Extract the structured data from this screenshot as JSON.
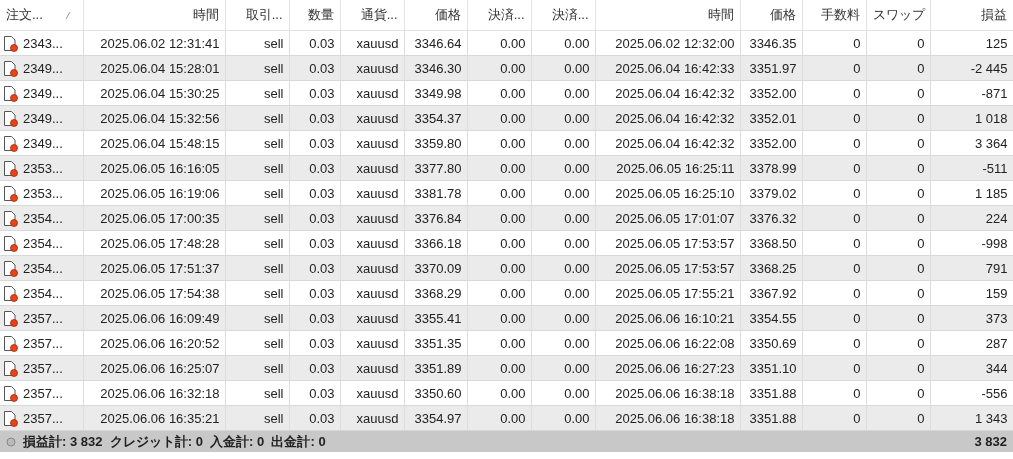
{
  "table": {
    "columns": [
      "注文...",
      "時間",
      "取引...",
      "数量",
      "通貨...",
      "価格",
      "決済...",
      "決済...",
      "時間",
      "価格",
      "手数料",
      "スワップ",
      "損益"
    ],
    "rows": [
      [
        "2343...",
        "2025.06.02 12:31:41",
        "sell",
        "0.03",
        "xauusd",
        "3346.64",
        "0.00",
        "0.00",
        "2025.06.02 12:32:00",
        "3346.35",
        "0",
        "0",
        "125"
      ],
      [
        "2349...",
        "2025.06.04 15:28:01",
        "sell",
        "0.03",
        "xauusd",
        "3346.30",
        "0.00",
        "0.00",
        "2025.06.04 16:42:33",
        "3351.97",
        "0",
        "0",
        "-2 445"
      ],
      [
        "2349...",
        "2025.06.04 15:30:25",
        "sell",
        "0.03",
        "xauusd",
        "3349.98",
        "0.00",
        "0.00",
        "2025.06.04 16:42:32",
        "3352.00",
        "0",
        "0",
        "-871"
      ],
      [
        "2349...",
        "2025.06.04 15:32:56",
        "sell",
        "0.03",
        "xauusd",
        "3354.37",
        "0.00",
        "0.00",
        "2025.06.04 16:42:32",
        "3352.01",
        "0",
        "0",
        "1 018"
      ],
      [
        "2349...",
        "2025.06.04 15:48:15",
        "sell",
        "0.03",
        "xauusd",
        "3359.80",
        "0.00",
        "0.00",
        "2025.06.04 16:42:32",
        "3352.00",
        "0",
        "0",
        "3 364"
      ],
      [
        "2353...",
        "2025.06.05 16:16:05",
        "sell",
        "0.03",
        "xauusd",
        "3377.80",
        "0.00",
        "0.00",
        "2025.06.05 16:25:11",
        "3378.99",
        "0",
        "0",
        "-511"
      ],
      [
        "2353...",
        "2025.06.05 16:19:06",
        "sell",
        "0.03",
        "xauusd",
        "3381.78",
        "0.00",
        "0.00",
        "2025.06.05 16:25:10",
        "3379.02",
        "0",
        "0",
        "1 185"
      ],
      [
        "2354...",
        "2025.06.05 17:00:35",
        "sell",
        "0.03",
        "xauusd",
        "3376.84",
        "0.00",
        "0.00",
        "2025.06.05 17:01:07",
        "3376.32",
        "0",
        "0",
        "224"
      ],
      [
        "2354...",
        "2025.06.05 17:48:28",
        "sell",
        "0.03",
        "xauusd",
        "3366.18",
        "0.00",
        "0.00",
        "2025.06.05 17:53:57",
        "3368.50",
        "0",
        "0",
        "-998"
      ],
      [
        "2354...",
        "2025.06.05 17:51:37",
        "sell",
        "0.03",
        "xauusd",
        "3370.09",
        "0.00",
        "0.00",
        "2025.06.05 17:53:57",
        "3368.25",
        "0",
        "0",
        "791"
      ],
      [
        "2354...",
        "2025.06.05 17:54:38",
        "sell",
        "0.03",
        "xauusd",
        "3368.29",
        "0.00",
        "0.00",
        "2025.06.05 17:55:21",
        "3367.92",
        "0",
        "0",
        "159"
      ],
      [
        "2357...",
        "2025.06.06 16:09:49",
        "sell",
        "0.03",
        "xauusd",
        "3355.41",
        "0.00",
        "0.00",
        "2025.06.06 16:10:21",
        "3354.55",
        "0",
        "0",
        "373"
      ],
      [
        "2357...",
        "2025.06.06 16:20:52",
        "sell",
        "0.03",
        "xauusd",
        "3351.35",
        "0.00",
        "0.00",
        "2025.06.06 16:22:08",
        "3350.69",
        "0",
        "0",
        "287"
      ],
      [
        "2357...",
        "2025.06.06 16:25:07",
        "sell",
        "0.03",
        "xauusd",
        "3351.89",
        "0.00",
        "0.00",
        "2025.06.06 16:27:23",
        "3351.10",
        "0",
        "0",
        "344"
      ],
      [
        "2357...",
        "2025.06.06 16:32:18",
        "sell",
        "0.03",
        "xauusd",
        "3350.60",
        "0.00",
        "0.00",
        "2025.06.06 16:38:18",
        "3351.88",
        "0",
        "0",
        "-556"
      ],
      [
        "2357...",
        "2025.06.06 16:35:21",
        "sell",
        "0.03",
        "xauusd",
        "3354.97",
        "0.00",
        "0.00",
        "2025.06.06 16:38:18",
        "3351.88",
        "0",
        "0",
        "1 343"
      ]
    ]
  },
  "summary": {
    "text": "損益計: 3 832  クレジット計: 0  入金計: 0  出金計: 0",
    "total": "3 832"
  }
}
